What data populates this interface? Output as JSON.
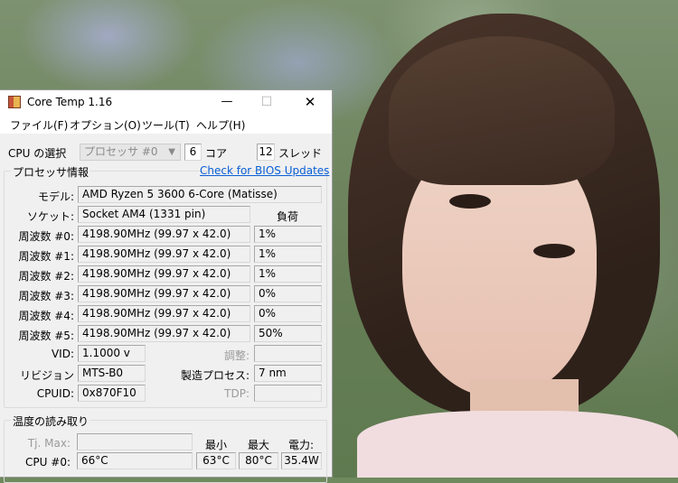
{
  "window": {
    "title": "Core Temp 1.16",
    "min_glyph": "—",
    "max_glyph": "☐",
    "close_glyph": "✕"
  },
  "menu": [
    "ファイル(F)",
    "オプション(O)",
    "ツール(T)",
    "ヘルプ(H)"
  ],
  "cpu_select": {
    "label": "CPU の選択",
    "value": "プロセッサ #0",
    "cores": "6",
    "cores_label": "コア",
    "threads": "12",
    "threads_label": "スレッド"
  },
  "processor_info": {
    "group_title": "プロセッサ情報",
    "bios_link": "Check for BIOS Updates",
    "model_label": "モデル:",
    "model": "AMD Ryzen 5 3600 6-Core (Matisse)",
    "socket_label": "ソケット:",
    "socket": "Socket AM4 (1331 pin)",
    "load_header": "負荷",
    "frequencies": [
      {
        "label": "周波数 #0:",
        "value": "4198.90MHz (99.97 x 42.0)",
        "load": "1%"
      },
      {
        "label": "周波数 #1:",
        "value": "4198.90MHz (99.97 x 42.0)",
        "load": "1%"
      },
      {
        "label": "周波数 #2:",
        "value": "4198.90MHz (99.97 x 42.0)",
        "load": "1%"
      },
      {
        "label": "周波数 #3:",
        "value": "4198.90MHz (99.97 x 42.0)",
        "load": "0%"
      },
      {
        "label": "周波数 #4:",
        "value": "4198.90MHz (99.97 x 42.0)",
        "load": "0%"
      },
      {
        "label": "周波数 #5:",
        "value": "4198.90MHz (99.97 x 42.0)",
        "load": "50%"
      }
    ],
    "vid_label": "VID:",
    "vid": "1.1000 v",
    "adjust_label": "調整:",
    "adjust": "",
    "revision_label": "リビジョン",
    "revision": "MTS-B0",
    "process_label": "製造プロセス:",
    "process": "7 nm",
    "cpuid_label": "CPUID:",
    "cpuid": "0x870F10",
    "tdp_label": "TDP:",
    "tdp": ""
  },
  "temperature": {
    "group_title": "温度の読み取り",
    "tjmax_label": "Tj. Max:",
    "tjmax": "",
    "min_header": "最小",
    "max_header": "最大",
    "power_header": "電力:",
    "cpu_label": "CPU #0:",
    "current": "66°C",
    "min": "63°C",
    "max": "80°C",
    "power": "35.4W"
  }
}
